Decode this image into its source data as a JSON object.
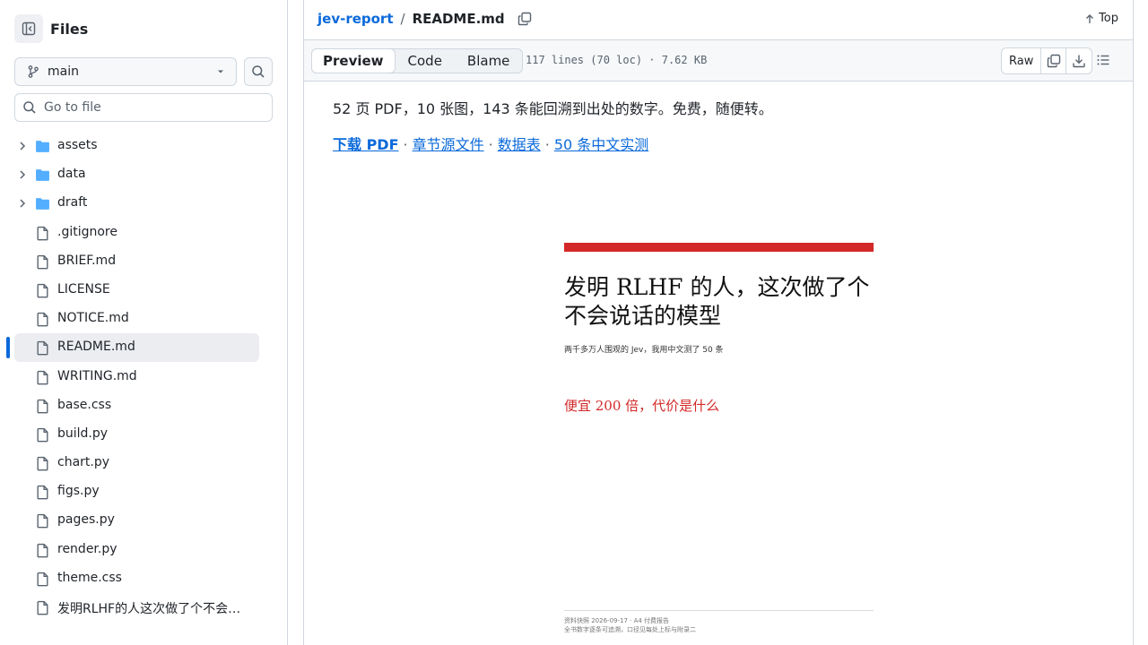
{
  "sidebar": {
    "title": "Files",
    "branch": "main",
    "goto_placeholder": "Go to file",
    "items": [
      {
        "name": "assets",
        "type": "folder"
      },
      {
        "name": "data",
        "type": "folder"
      },
      {
        "name": "draft",
        "type": "folder"
      },
      {
        "name": ".gitignore",
        "type": "file"
      },
      {
        "name": "BRIEF.md",
        "type": "file"
      },
      {
        "name": "LICENSE",
        "type": "file"
      },
      {
        "name": "NOTICE.md",
        "type": "file"
      },
      {
        "name": "README.md",
        "type": "file",
        "selected": true
      },
      {
        "name": "WRITING.md",
        "type": "file"
      },
      {
        "name": "base.css",
        "type": "file"
      },
      {
        "name": "build.py",
        "type": "file"
      },
      {
        "name": "chart.py",
        "type": "file"
      },
      {
        "name": "figs.py",
        "type": "file"
      },
      {
        "name": "pages.py",
        "type": "file"
      },
      {
        "name": "render.py",
        "type": "file"
      },
      {
        "name": "theme.css",
        "type": "file"
      },
      {
        "name": "发明RLHF的人这次做了个不会…",
        "type": "file"
      }
    ]
  },
  "header": {
    "repo": "jev-report",
    "separator": "/",
    "file": "README.md",
    "top_label": "Top"
  },
  "toolbar": {
    "tabs": [
      "Preview",
      "Code",
      "Blame"
    ],
    "active_tab": "Preview",
    "meta": "117 lines (70 loc) · 7.62 KB",
    "raw_label": "Raw"
  },
  "content": {
    "paragraph": "52 页 PDF，10 张图，143 条能回溯到出处的数字。免费，随便转。",
    "links": {
      "download": "下载 PDF",
      "sources": "章节源文件",
      "data": "数据表",
      "tests": "50 条中文实测",
      "dot": "·"
    },
    "cover": {
      "title_line1": "发明 RLHF 的人，这次做了个",
      "title_line2": "不会说话的模型",
      "subtitle": "两千多万人围观的 Jev，我用中文测了 50 条",
      "red_heading": "便宜 200 倍，代价是什么",
      "footer_line1": "资料快照 2026-09-17  ·  A4 付费报告",
      "footer_line2": "全书数字逐条可追溯，口径见每处上标与附录二"
    }
  },
  "colors": {
    "link": "#0969da",
    "accent_red": "#d32828",
    "folder": "#54aeff",
    "border": "#d0d7de"
  }
}
